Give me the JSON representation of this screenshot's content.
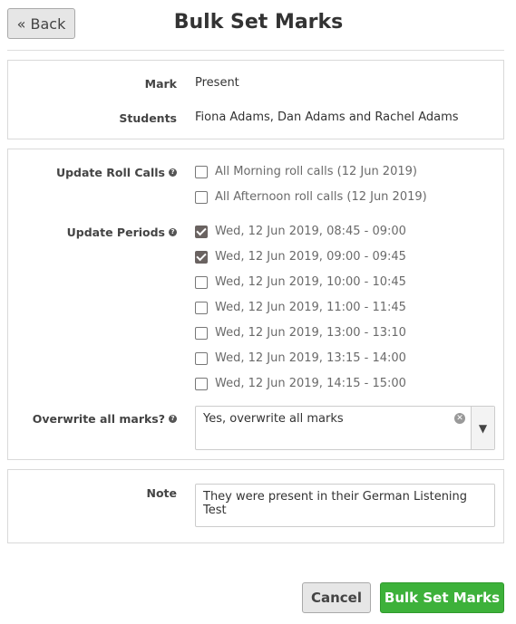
{
  "header": {
    "back_label": "« Back",
    "title": "Bulk Set Marks"
  },
  "summary": {
    "mark_label": "Mark",
    "mark_value": "Present",
    "students_label": "Students",
    "students_value": "Fiona Adams, Dan Adams and Rachel Adams"
  },
  "roll_calls": {
    "label": "Update Roll Calls",
    "items": [
      {
        "label": "All Morning roll calls (12 Jun 2019)",
        "checked": false
      },
      {
        "label": "All Afternoon roll calls (12 Jun 2019)",
        "checked": false
      }
    ]
  },
  "periods": {
    "label": "Update Periods",
    "items": [
      {
        "label": "Wed, 12 Jun 2019, 08:45 - 09:00",
        "checked": true
      },
      {
        "label": "Wed, 12 Jun 2019, 09:00 - 09:45",
        "checked": true
      },
      {
        "label": "Wed, 12 Jun 2019, 10:00 - 10:45",
        "checked": false
      },
      {
        "label": "Wed, 12 Jun 2019, 11:00 - 11:45",
        "checked": false
      },
      {
        "label": "Wed, 12 Jun 2019, 13:00 - 13:10",
        "checked": false
      },
      {
        "label": "Wed, 12 Jun 2019, 13:15 - 14:00",
        "checked": false
      },
      {
        "label": "Wed, 12 Jun 2019, 14:15 - 15:00",
        "checked": false
      }
    ]
  },
  "overwrite": {
    "label": "Overwrite all marks?",
    "value": "Yes, overwrite all marks"
  },
  "note": {
    "label": "Note",
    "value": "They were present in their German Listening Test"
  },
  "footer": {
    "cancel_label": "Cancel",
    "submit_label": "Bulk Set Marks"
  },
  "colors": {
    "submit_green": "#3db13a",
    "checkbox_checked": "#6a6361"
  }
}
